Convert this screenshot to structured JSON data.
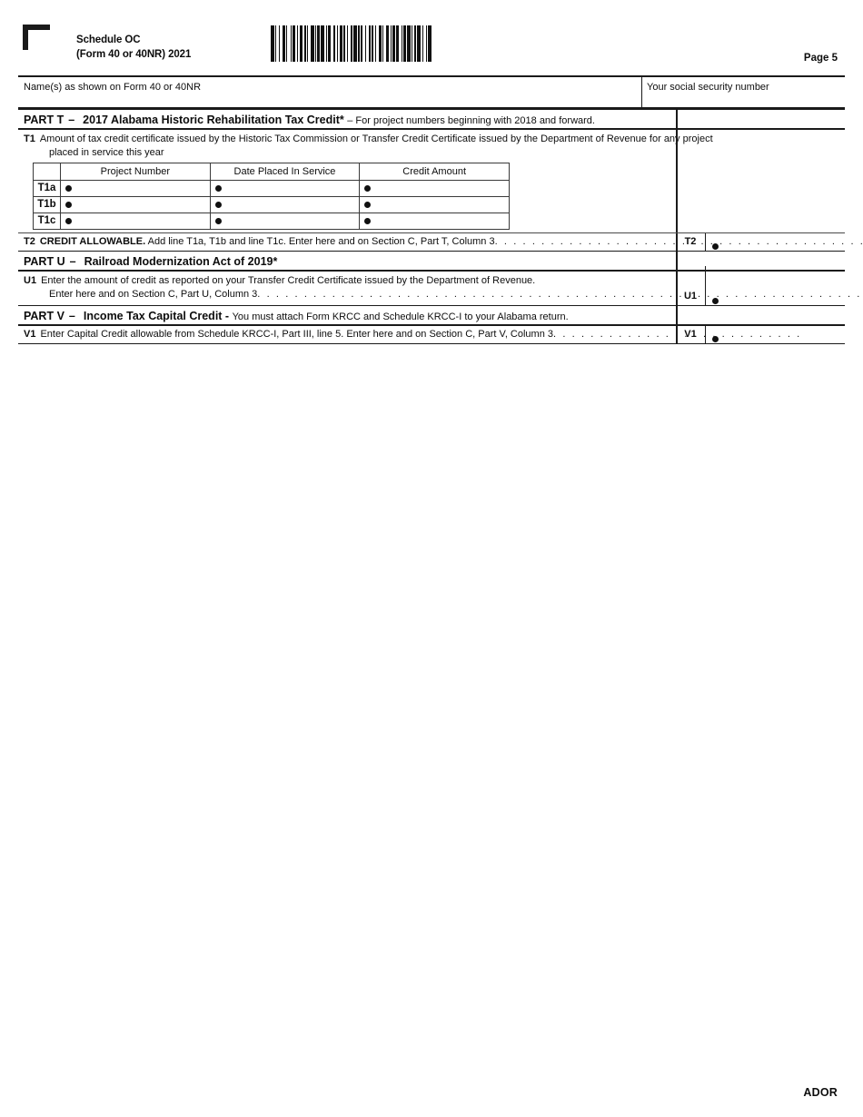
{
  "header": {
    "schedule": "Schedule OC",
    "form_line": "(Form 40 or 40NR) 2021",
    "page_label": "Page 5",
    "barcode_alt": "barcode"
  },
  "id_band": {
    "name_label": "Name(s) as shown on Form 40 or 40NR",
    "ssn_label": "Your social security number"
  },
  "parts": {
    "t": {
      "part_label": "PART T",
      "dash": "–",
      "title": "2017 Alabama Historic Rehabilitation Tax Credit*",
      "subtitle": "– For project numbers beginning with 2018 and forward.",
      "t1": {
        "no": "T1",
        "text_line1": "Amount of tax credit certificate issued by the Historic Tax Commission or Transfer Credit Certificate issued by the Department of Revenue for any project",
        "text_line2": "placed in service this year"
      },
      "table": {
        "headers": [
          "",
          "Project Number",
          "Date Placed In Service",
          "Credit Amount"
        ],
        "rows": [
          {
            "label": "T1a",
            "project_number": "",
            "date_placed": "",
            "credit_amount": ""
          },
          {
            "label": "T1b",
            "project_number": "",
            "date_placed": "",
            "credit_amount": ""
          },
          {
            "label": "T1c",
            "project_number": "",
            "date_placed": "",
            "credit_amount": ""
          }
        ]
      },
      "t2": {
        "no": "T2",
        "bold_text": "CREDIT ALLOWABLE.",
        "text": "Add line T1a, T1b and line T1c. Enter here and on Section C, Part T, Column 3",
        "leader": ". . . . . . . . . . . . . . . . . . . . . . . . . . . . . . . . . . . . . . . .",
        "code": "T2",
        "value": ""
      }
    },
    "u": {
      "part_label": "PART U",
      "dash": "–",
      "title": "Railroad Modernization Act of 2019*",
      "u1": {
        "no": "U1",
        "text_line1": "Enter the amount of credit as reported on your Transfer Credit Certificate issued by the Department of Revenue.",
        "text_line2": "Enter here and on Section C, Part U, Column 3",
        "leader": ". . . . . . . . . . . . . . . . . . . . . . . . . . . . . . . . . . . . . . . . . . . . . . . . . . . . . . . . . . . . . . . . . . . . .",
        "code": "U1",
        "value": ""
      }
    },
    "v": {
      "part_label": "PART V",
      "dash": "–",
      "title": "Income Tax Capital Credit -",
      "subtitle": "You must attach Form KRCC and Schedule KRCC-I to your Alabama return.",
      "v1": {
        "no": "V1",
        "text": "Enter Capital Credit allowable from Schedule KRCC-I, Part III, line 5. Enter here and on Section C, Part V, Column 3",
        "leader": ". . . . . . . . . . . . . . . . . . . . . . . . . . .",
        "code": "V1",
        "value": ""
      }
    }
  },
  "footer": {
    "ador": "ADOR"
  }
}
